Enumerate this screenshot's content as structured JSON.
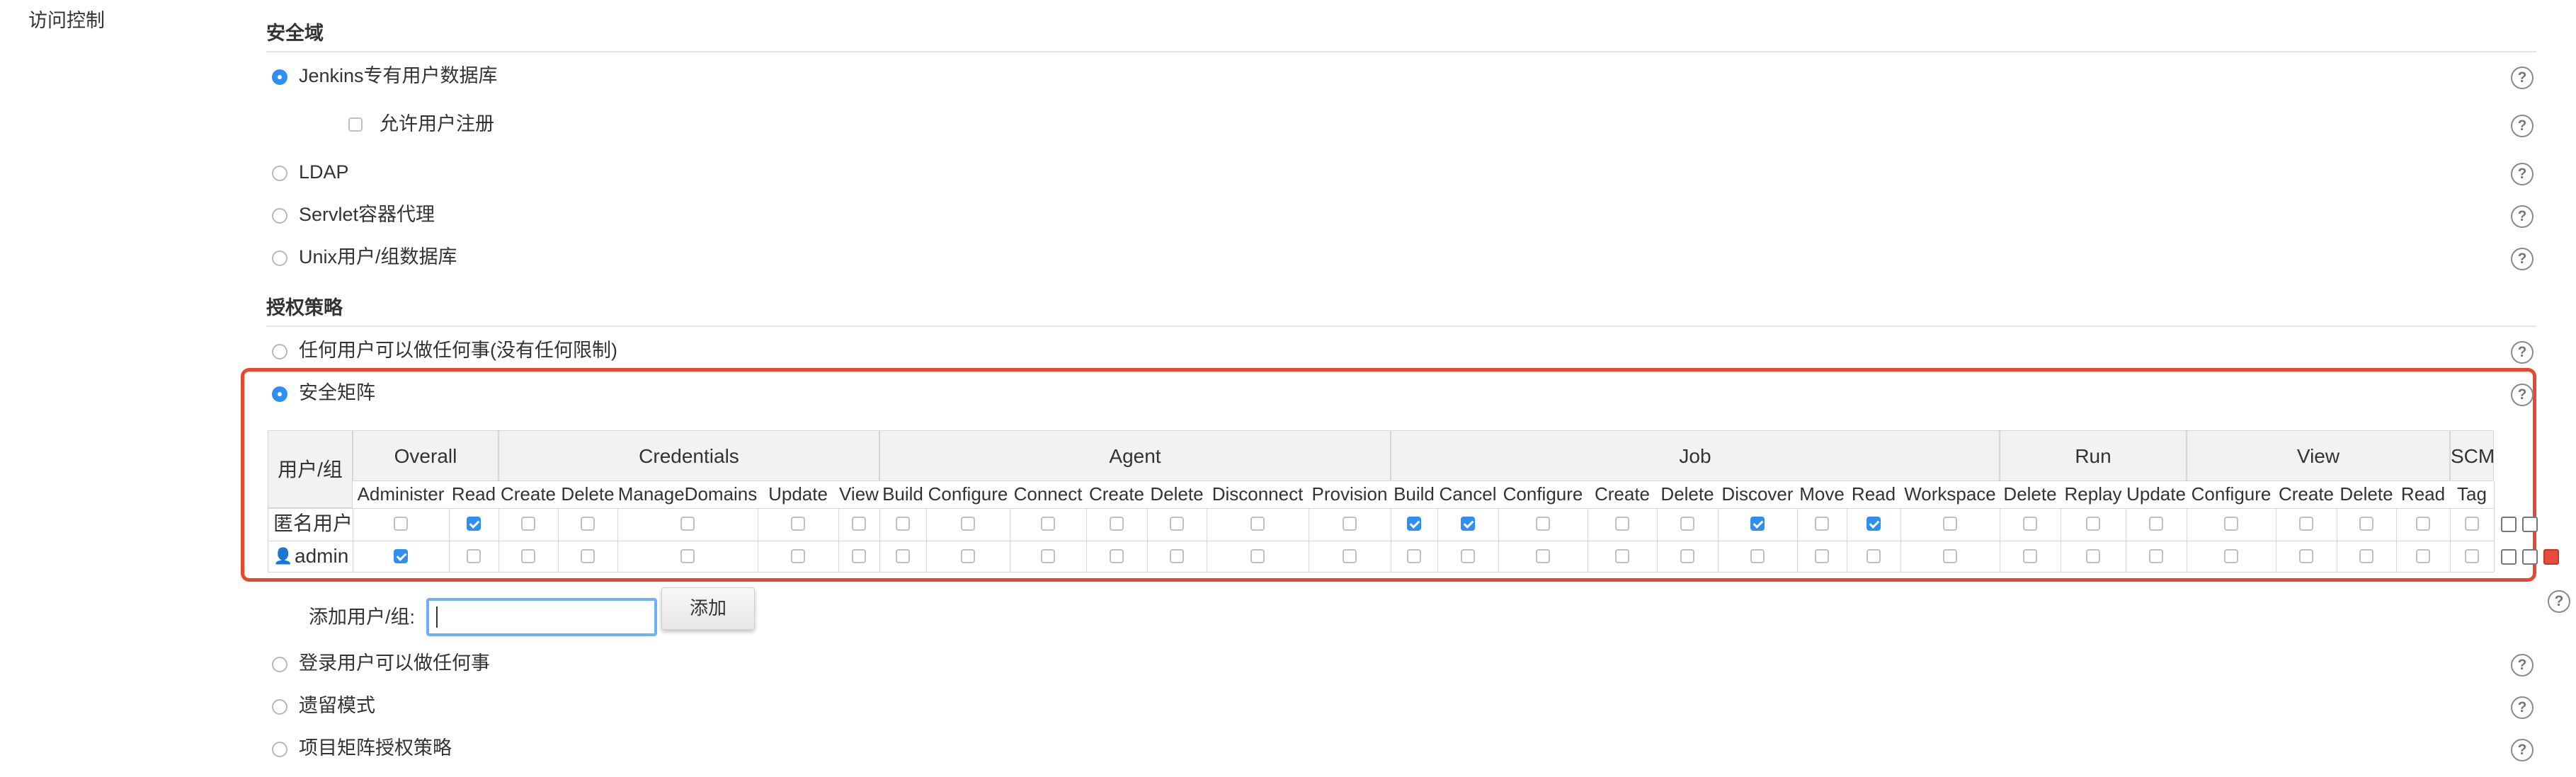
{
  "section": {
    "label": "访问控制"
  },
  "security_realm": {
    "title": "安全域",
    "options": [
      {
        "label": "Jenkins专有用户数据库",
        "selected": true
      },
      {
        "label": "LDAP",
        "selected": false
      },
      {
        "label": "Servlet容器代理",
        "selected": false
      },
      {
        "label": "Unix用户/组数据库",
        "selected": false
      }
    ],
    "allow_signup": {
      "label": "允许用户注册",
      "checked": false
    }
  },
  "authorization": {
    "title": "授权策略",
    "options": [
      {
        "label": "任何用户可以做任何事(没有任何限制)",
        "selected": false
      },
      {
        "label": "安全矩阵",
        "selected": true
      },
      {
        "label": "登录用户可以做任何事",
        "selected": false
      },
      {
        "label": "遗留模式",
        "selected": false
      },
      {
        "label": "项目矩阵授权策略",
        "selected": false
      }
    ]
  },
  "matrix": {
    "user_group_header": "用户/组",
    "groups": [
      {
        "name": "Overall",
        "perms": [
          "Administer",
          "Read"
        ]
      },
      {
        "name": "Credentials",
        "perms": [
          "Create",
          "Delete",
          "ManageDomains",
          "Update",
          "View"
        ]
      },
      {
        "name": "Agent",
        "perms": [
          "Build",
          "Configure",
          "Connect",
          "Create",
          "Delete",
          "Disconnect",
          "Provision"
        ]
      },
      {
        "name": "Job",
        "perms": [
          "Build",
          "Cancel",
          "Configure",
          "Create",
          "Delete",
          "Discover",
          "Move",
          "Read",
          "Workspace"
        ]
      },
      {
        "name": "Run",
        "perms": [
          "Delete",
          "Replay",
          "Update"
        ]
      },
      {
        "name": "View",
        "perms": [
          "Configure",
          "Create",
          "Delete",
          "Read"
        ]
      },
      {
        "name": "SCM",
        "perms": [
          "Tag"
        ]
      }
    ],
    "rows": [
      {
        "name": "匿名用户",
        "has_user_icon": false,
        "checked": [
          0,
          1,
          0,
          0,
          0,
          0,
          0,
          0,
          0,
          0,
          0,
          0,
          0,
          0,
          1,
          1,
          0,
          0,
          0,
          1,
          0,
          1,
          0,
          0,
          0,
          0,
          0,
          0,
          0,
          0,
          0
        ]
      },
      {
        "name": "admin",
        "has_user_icon": true,
        "checked": [
          1,
          0,
          0,
          0,
          0,
          0,
          0,
          0,
          0,
          0,
          0,
          0,
          0,
          0,
          0,
          0,
          0,
          0,
          0,
          0,
          0,
          0,
          0,
          0,
          0,
          0,
          0,
          0,
          0,
          0,
          0
        ]
      }
    ]
  },
  "add_user": {
    "label": "添加用户/组:",
    "value": "",
    "button_label": "添加"
  },
  "icons": {
    "help": "help-icon",
    "check_all": "check-all-icon",
    "copy_row": "copy-icon",
    "remove_row": "remove-icon",
    "user": "user-icon"
  },
  "colors": {
    "accent": "#2f8ef2",
    "highlight_border": "#e8482e",
    "help_symbol": "?"
  }
}
